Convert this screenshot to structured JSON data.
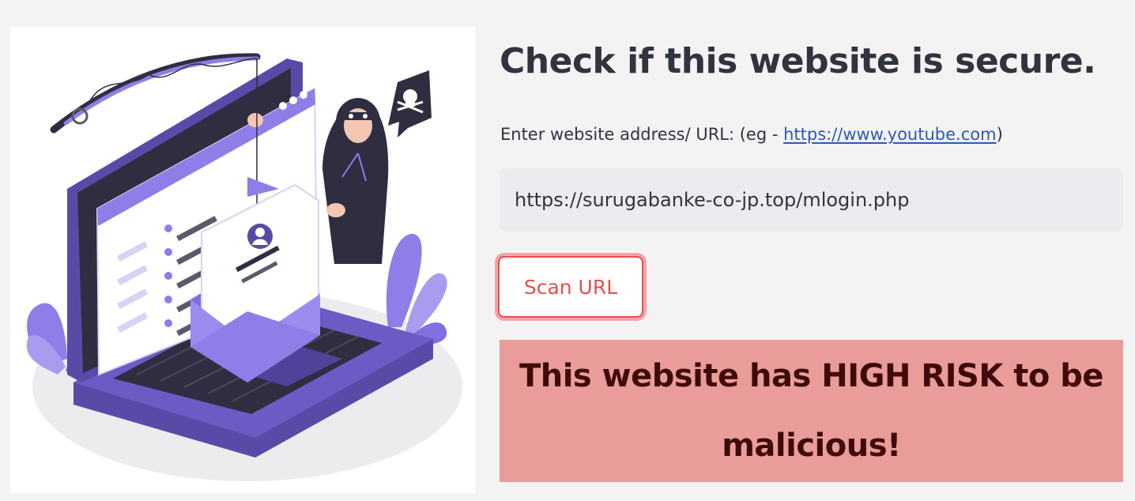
{
  "header": {
    "title": "Check if this website is secure."
  },
  "form": {
    "label_prefix": "Enter website address/ URL: (eg - ",
    "example_link": "https://www.youtube.com",
    "label_suffix": ")",
    "url_value": "https://surugabanke-co-jp.top/mlogin.php",
    "scan_label": "Scan URL"
  },
  "result": {
    "message": "This website has HIGH RISK to be malicious!",
    "status": "high-risk"
  },
  "illustration": {
    "subject": "phishing hacker with fishing rod over laptop and email"
  },
  "colors": {
    "accent_purple": "#6c5ce7",
    "danger_red": "#e0524d",
    "result_bg": "#e99c9a",
    "link_blue": "#2c58b8"
  }
}
